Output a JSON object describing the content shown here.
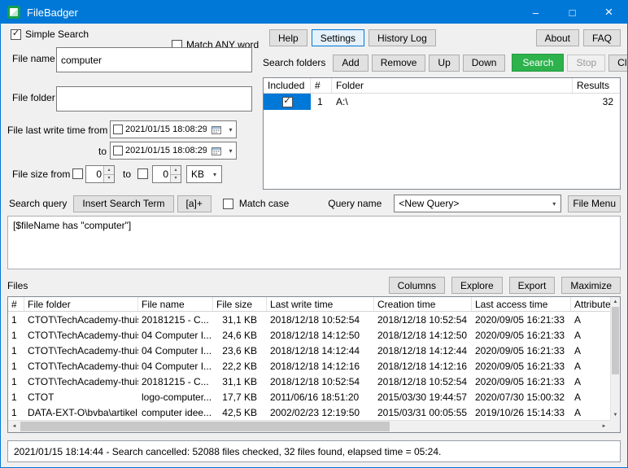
{
  "window": {
    "title": "FileBadger"
  },
  "titlebar_icons": {
    "minimize": "–",
    "maximize": "□",
    "close": "×"
  },
  "glyphs": {
    "check": "✓",
    "dropdown": "▾",
    "spin_up": "▴",
    "spin_down": "▾",
    "left": "◄",
    "right": "►",
    "up": "▲",
    "down": "▼"
  },
  "search_panel": {
    "simple_search": "Simple Search",
    "match_any_word": "Match ANY word",
    "file_name_label": "File name",
    "file_name_value": "computer",
    "file_folder_label": "File folder",
    "file_folder_value": "",
    "last_write_from_label": "File last write time from",
    "to_label": "to",
    "date_from": "2021/01/15 18:08:29",
    "date_to": "2021/01/15 18:08:29",
    "file_size_from_label": "File size from",
    "size_to_label": "to",
    "size_from": "0",
    "size_to": "0",
    "size_unit": "KB"
  },
  "toolbar": {
    "help": "Help",
    "settings": "Settings",
    "history_log": "History Log",
    "about": "About",
    "faq": "FAQ"
  },
  "folders": {
    "label": "Search folders",
    "add": "Add",
    "remove": "Remove",
    "up": "Up",
    "down": "Down",
    "search": "Search",
    "stop": "Stop",
    "clear": "Clear",
    "headers": [
      "Included",
      "#",
      "Folder",
      "Results"
    ],
    "rows": [
      {
        "included": true,
        "num": "1",
        "folder": "A:\\",
        "results": "32"
      }
    ]
  },
  "query": {
    "label": "Search query",
    "insert_term": "Insert Search Term",
    "regex_button": "[a]+",
    "match_case": "Match case",
    "query_name_label": "Query name",
    "query_name_value": "<New Query>",
    "file_menu": "File Menu",
    "text": "[$fileName has \"computer\"]"
  },
  "files": {
    "label": "Files",
    "columns_btn": "Columns",
    "explore_btn": "Explore",
    "export_btn": "Export",
    "maximize_btn": "Maximize",
    "headers": [
      "#",
      "File folder",
      "File name",
      "File size",
      "Last write time",
      "Creation time",
      "Last access time",
      "Attributes"
    ],
    "rows": [
      [
        "1",
        "CTOT\\TechAcademy-thuis...",
        "20181215 - C...",
        "31,1 KB",
        "2018/12/18 10:52:54",
        "2018/12/18 10:52:54",
        "2020/09/05 16:21:33",
        "A"
      ],
      [
        "1",
        "CTOT\\TechAcademy-thuis...",
        "04 Computer I...",
        "24,6 KB",
        "2018/12/18 14:12:50",
        "2018/12/18 14:12:50",
        "2020/09/05 16:21:33",
        "A"
      ],
      [
        "1",
        "CTOT\\TechAcademy-thuis...",
        "04 Computer I...",
        "23,6 KB",
        "2018/12/18 14:12:44",
        "2018/12/18 14:12:44",
        "2020/09/05 16:21:33",
        "A"
      ],
      [
        "1",
        "CTOT\\TechAcademy-thuis...",
        "04 Computer I...",
        "22,2 KB",
        "2018/12/18 14:12:16",
        "2018/12/18 14:12:16",
        "2020/09/05 16:21:33",
        "A"
      ],
      [
        "1",
        "CTOT\\TechAcademy-thuis...",
        "20181215 - C...",
        "31,1 KB",
        "2018/12/18 10:52:54",
        "2018/12/18 10:52:54",
        "2020/09/05 16:21:33",
        "A"
      ],
      [
        "1",
        "CTOT",
        "logo-computer...",
        "17,7 KB",
        "2011/06/16 18:51:20",
        "2015/03/30 19:44:57",
        "2020/07/30 15:00:32",
        "A"
      ],
      [
        "1",
        "DATA-EXT-O\\bvba\\artikel...",
        "computer idee...",
        "42,5 KB",
        "2002/02/23 12:19:50",
        "2015/03/31 00:05:55",
        "2019/10/26 15:14:33",
        "A"
      ]
    ]
  },
  "status": {
    "text": "2021/01/15 18:14:44 - Search cancelled: 52088 files checked, 32 files found, elapsed time = 05:24."
  }
}
